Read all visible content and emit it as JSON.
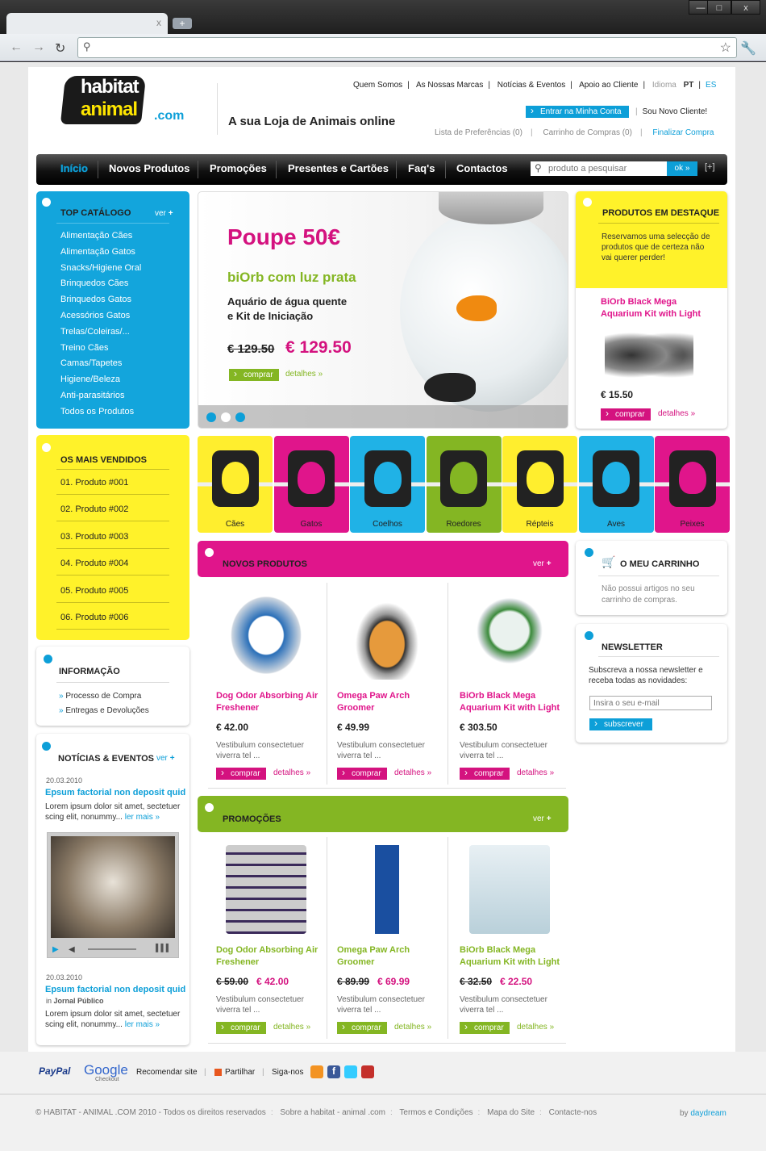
{
  "browser": {
    "close_label": "x",
    "newtab_label": "+",
    "win_min": "—",
    "win_max": "□",
    "win_close": "x",
    "back_icon": "arrow-left-icon",
    "forward_icon": "arrow-right-icon",
    "reload_icon": "reload-icon",
    "star_icon": "star-icon",
    "wrench_icon": "wrench-icon"
  },
  "header": {
    "logo_line1": "habitat",
    "logo_line2": "animal",
    "logo_suffix": ".com",
    "tagline": "A sua Loja de Animais online",
    "top_links": [
      "Quem Somos",
      "As Nossas Marcas",
      "Notícias & Eventos",
      "Apoio ao Cliente"
    ],
    "idioma_label": "Idioma",
    "lang_pt": "PT",
    "lang_es": "ES",
    "login_button": "Entrar na Minha Conta",
    "new_client": "Sou Novo Cliente!",
    "wishlist": "Lista de Preferências (0)",
    "cart": "Carrinho de Compras (0)",
    "checkout": "Finalizar Compra"
  },
  "menu": {
    "items": [
      "Início",
      "Novos Produtos",
      "Promoções",
      "Presentes e Cartões",
      "Faq's",
      "Contactos"
    ],
    "search_placeholder": "produto a pesquisar",
    "search_button": "ok »",
    "expand": "[+]"
  },
  "top_catalog": {
    "title": "TOP CATÁLOGO",
    "ver": "ver",
    "items": [
      "Alimentação Cães",
      "Alimentação Gatos",
      "Snacks/Higiene Oral",
      "Brinquedos Cães",
      "Brinquedos Gatos",
      "Acessórios Gatos",
      "Trelas/Coleiras/...",
      "Treino Cães",
      "Camas/Tapetes",
      "Higiene/Beleza",
      "Anti-parasitários",
      "Todos os Produtos"
    ]
  },
  "best_sellers": {
    "title": "OS MAIS VENDIDOS",
    "items": [
      "01. Produto #001",
      "02. Produto #002",
      "03. Produto #003",
      "04. Produto #004",
      "05. Produto #005",
      "06. Produto #006"
    ]
  },
  "info": {
    "title": "INFORMAÇÃO",
    "items": [
      "Processo de Compra",
      "Entregas e Devoluções"
    ]
  },
  "news": {
    "title": "NOTÍCIAS & EVENTOS",
    "ver": "ver",
    "item1": {
      "date": "20.03.2010",
      "title": "Epsum factorial non deposit quid",
      "text": "Lorem ipsum dolor sit amet, sectetuer scing elit, nonummy...",
      "more": "ler mais »"
    },
    "item2": {
      "date": "20.03.2010",
      "title": "Epsum factorial non deposit quid",
      "source_prefix": "in",
      "source": "Jornal Público",
      "text": "Lorem ipsum dolor sit amet, sectetuer scing elit, nonummy...",
      "more": "ler mais »"
    }
  },
  "hero": {
    "headline": "Poupe 50€",
    "subtitle": "biOrb com luz prata",
    "desc1": "Aquário de água quente",
    "desc2": "e Kit de Iniciação",
    "old_price": "€ 129.50",
    "new_price": "€ 129.50",
    "buy": "comprar",
    "details": "detalhes »",
    "slides": 3,
    "active_slide": 1
  },
  "featured": {
    "title": "PRODUTOS EM DESTAQUE",
    "intro": "Reservamos uma selecção de produtos que de certeza não vai querer perder!",
    "product": "BiOrb Black Mega Aquarium Kit with Light",
    "price": "€ 15.50",
    "buy": "comprar",
    "details": "detalhes »"
  },
  "categories": [
    {
      "label": "Cães",
      "color": "#ffee2e"
    },
    {
      "label": "Gatos",
      "color": "#e0158b"
    },
    {
      "label": "Coelhos",
      "color": "#20b2e6"
    },
    {
      "label": "Roedores",
      "color": "#84b623"
    },
    {
      "label": "Répteis",
      "color": "#ffee2e"
    },
    {
      "label": "Aves",
      "color": "#20b2e6"
    },
    {
      "label": "Peixes",
      "color": "#e0158b"
    }
  ],
  "new_products": {
    "title": "NOVOS PRODUTOS",
    "ver": "ver",
    "items": [
      {
        "name1": "Dog Odor Absorbing Air",
        "name2": "Freshener",
        "price": "€ 42.00",
        "desc1": "Vestibulum consectetuer",
        "desc2": "viverra tel ...",
        "buy": "comprar",
        "details": "detalhes »"
      },
      {
        "name1": "Omega Paw Arch",
        "name2": "Groomer",
        "price": "€ 49.99",
        "desc1": "Vestibulum consectetuer",
        "desc2": "viverra tel ...",
        "buy": "comprar",
        "details": "detalhes »"
      },
      {
        "name1": "BiOrb Black Mega",
        "name2": "Aquarium Kit with Light",
        "price": "€ 303.50",
        "desc1": "Vestibulum consectetuer",
        "desc2": "viverra tel ...",
        "buy": "comprar",
        "details": "detalhes »"
      }
    ]
  },
  "promotions": {
    "title": "PROMOÇÕES",
    "ver": "ver",
    "items": [
      {
        "name1": "Dog Odor Absorbing Air",
        "name2": "Freshener",
        "old": "€ 59.00",
        "price": "€ 42.00",
        "desc1": "Vestibulum consectetuer",
        "desc2": "viverra tel ...",
        "buy": "comprar",
        "details": "detalhes »"
      },
      {
        "name1": "Omega Paw Arch",
        "name2": "Groomer",
        "old": "€ 89.99",
        "price": "€ 69.99",
        "desc1": "Vestibulum consectetuer",
        "desc2": "viverra tel ...",
        "buy": "comprar",
        "details": "detalhes »"
      },
      {
        "name1": "BiOrb Black Mega",
        "name2": "Aquarium Kit with Light",
        "old": "€ 32.50",
        "price": "€ 22.50",
        "desc1": "Vestibulum consectetuer",
        "desc2": "viverra tel ...",
        "buy": "comprar",
        "details": "detalhes »"
      }
    ]
  },
  "cart_box": {
    "title": "O MEU CARRINHO",
    "text1": "Não possui artigos no seu",
    "text2": "carrinho de compras."
  },
  "newsletter": {
    "title": "NEWSLETTER",
    "text1": "Subscreva a nossa newsletter e",
    "text2": "receba todas as novidades:",
    "placeholder": "Insira o seu e-mail",
    "button": "subscrever"
  },
  "footer": {
    "paypal": "PayPal",
    "google": "Google",
    "checkout": "Checkout",
    "recommend": "Recomendar site",
    "share": "Partilhar",
    "follow": "Siga-nos",
    "copyright": "© HABITAT - ANIMAL .COM 2010 - Todos os direitos reservados",
    "links": [
      "Sobre a habitat - animal .com",
      "Termos e Condições",
      "Mapa do Site",
      "Contacte-nos"
    ],
    "by": "by",
    "by_brand": "daydream"
  }
}
